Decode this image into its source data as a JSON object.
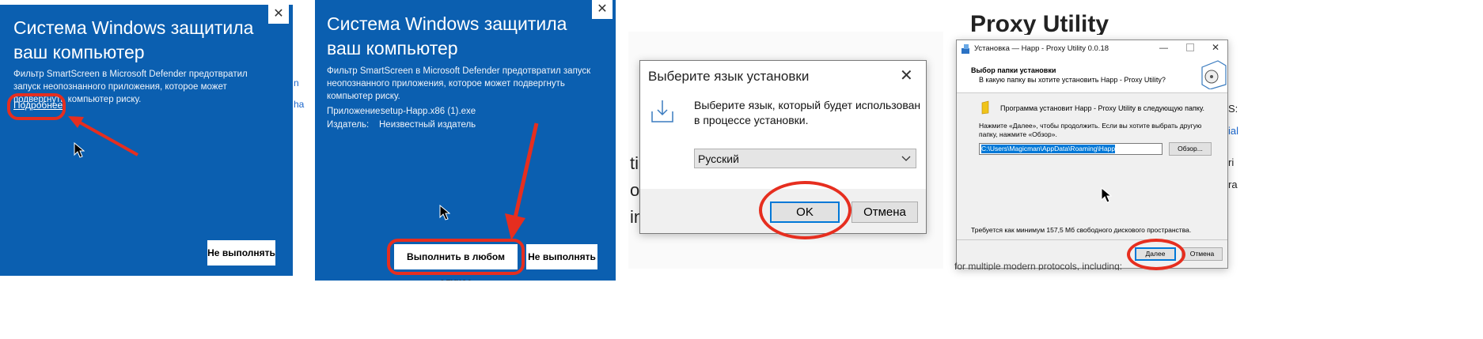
{
  "panel1": {
    "title": "Система Windows защитила ваш компьютер",
    "body": "Фильтр SmartScreen в Microsoft Defender предотвратил запуск неопознанного приложения, которое может подвергнуть компьютер риску.",
    "more_link": "Подробнее",
    "dont_run": "Не выполнять",
    "close_glyph": "✕",
    "side_fragments": [
      "n",
      "ha"
    ]
  },
  "panel2": {
    "title": "Система Windows защитила ваш компьютер",
    "body": "Фильтр SmartScreen в Microsoft Defender предотвратил запуск неопознанного приложения, которое может подвергнуть компьютер риску.",
    "app_label": "Приложение:",
    "app_value": "setup-Happ.x86 (1).exe",
    "publisher_label": "Издатель:",
    "publisher_value": "Неизвестный издатель",
    "run_anyway": "Выполнить в любом случае",
    "dont_run": "Не выполнять",
    "close_glyph": "✕"
  },
  "panel3": {
    "title": "Выберите язык установки",
    "prompt": "Выберите язык, который будет использован в процессе установки.",
    "language": "Русский",
    "ok": "OK",
    "cancel": "Отмена",
    "close_glyph": "✕",
    "bg_fragments": [
      "ti",
      "op",
      "in"
    ]
  },
  "panel4": {
    "window_title": "Установка — Happ - Proxy Utility 0.0.18",
    "bg_heading": "Proxy Utility",
    "header_title": "Выбор папки установки",
    "header_subtitle": "В какую папку вы хотите установить Happ - Proxy Utility?",
    "install_line": "Программа установит Happ - Proxy Utility в следующую папку.",
    "instructions": "Нажмите «Далее», чтобы продолжить. Если вы хотите выбрать другую папку, нажмите «Обзор».",
    "path": "C:\\Users\\Magicman\\AppData\\Roaming\\Happ",
    "browse": "Обзор...",
    "space_note": "Требуется как минимум 157,5 Мб свободного дискового пространства.",
    "next": "Далее",
    "cancel": "Отмена",
    "bg_footer": "for multiple modern protocols, including:",
    "right_fragments": [
      "S:",
      "ial",
      "ri",
      "ra"
    ]
  }
}
